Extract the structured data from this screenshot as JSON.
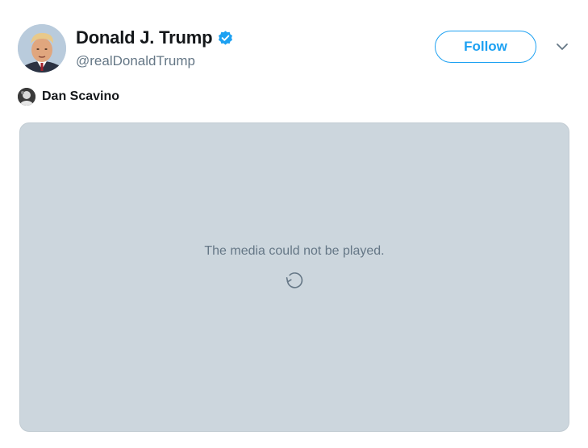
{
  "tweet": {
    "author": {
      "display_name": "Donald J. Trump",
      "handle": "@realDonaldTrump",
      "verified": true,
      "avatar_icon": "profile-photo"
    },
    "follow_label": "Follow",
    "caret_icon": "chevron-down-icon",
    "attribution": {
      "name": "Dan Scavino",
      "avatar_icon": "profile-photo"
    },
    "media": {
      "message": "The media could not be played.",
      "reload_icon": "reload-icon"
    }
  },
  "colors": {
    "brand_blue": "#1da1f2",
    "text_primary": "#14171a",
    "text_secondary": "#657786",
    "media_background": "#ccd6dd"
  }
}
